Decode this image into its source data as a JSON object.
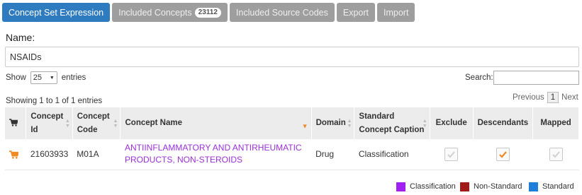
{
  "tabs": [
    {
      "label": "Concept Set Expression",
      "active": true
    },
    {
      "label": "Included Concepts",
      "badge": "23112"
    },
    {
      "label": "Included Source Codes"
    },
    {
      "label": "Export"
    },
    {
      "label": "Import"
    }
  ],
  "name_field": {
    "label": "Name:",
    "value": "NSAIDs"
  },
  "length_control": {
    "show_label": "Show",
    "selected": "25",
    "entries_label": "entries"
  },
  "search": {
    "label": "Search:",
    "value": ""
  },
  "info_text": "Showing 1 to 1 of 1 entries",
  "pagination": {
    "previous": "Previous",
    "current": "1",
    "next": "Next"
  },
  "table": {
    "columns": [
      {
        "key": "cart",
        "label": ""
      },
      {
        "key": "concept_id",
        "label": "Concept Id"
      },
      {
        "key": "concept_code",
        "label": "Concept Code"
      },
      {
        "key": "concept_name",
        "label": "Concept Name"
      },
      {
        "key": "domain",
        "label": "Domain"
      },
      {
        "key": "standard_caption",
        "label": "Standard Concept Caption"
      },
      {
        "key": "exclude",
        "label": "Exclude"
      },
      {
        "key": "descendants",
        "label": "Descendants"
      },
      {
        "key": "mapped",
        "label": "Mapped"
      }
    ],
    "rows": [
      {
        "concept_id": "21603933",
        "concept_code": "M01A",
        "concept_name": "ANTIINFLAMMATORY AND ANTIRHEUMATIC PRODUCTS, NON-STEROIDS",
        "domain": "Drug",
        "standard_caption": "Classification",
        "exclude": false,
        "descendants": true,
        "mapped": false
      }
    ]
  },
  "legend": [
    {
      "label": "Classification",
      "color": "#a020f0"
    },
    {
      "label": "Non-Standard",
      "color": "#a11a1a"
    },
    {
      "label": "Standard",
      "color": "#1e7fd8"
    }
  ],
  "colors": {
    "tab_active": "#2f7bbf",
    "tab_inactive": "#9e9e9e",
    "accent_orange": "#f08a24",
    "link_purple": "#9b30d9"
  },
  "icons": {
    "cart": "shopping-cart-icon",
    "check": "check-icon",
    "sort": "sort-icon"
  }
}
